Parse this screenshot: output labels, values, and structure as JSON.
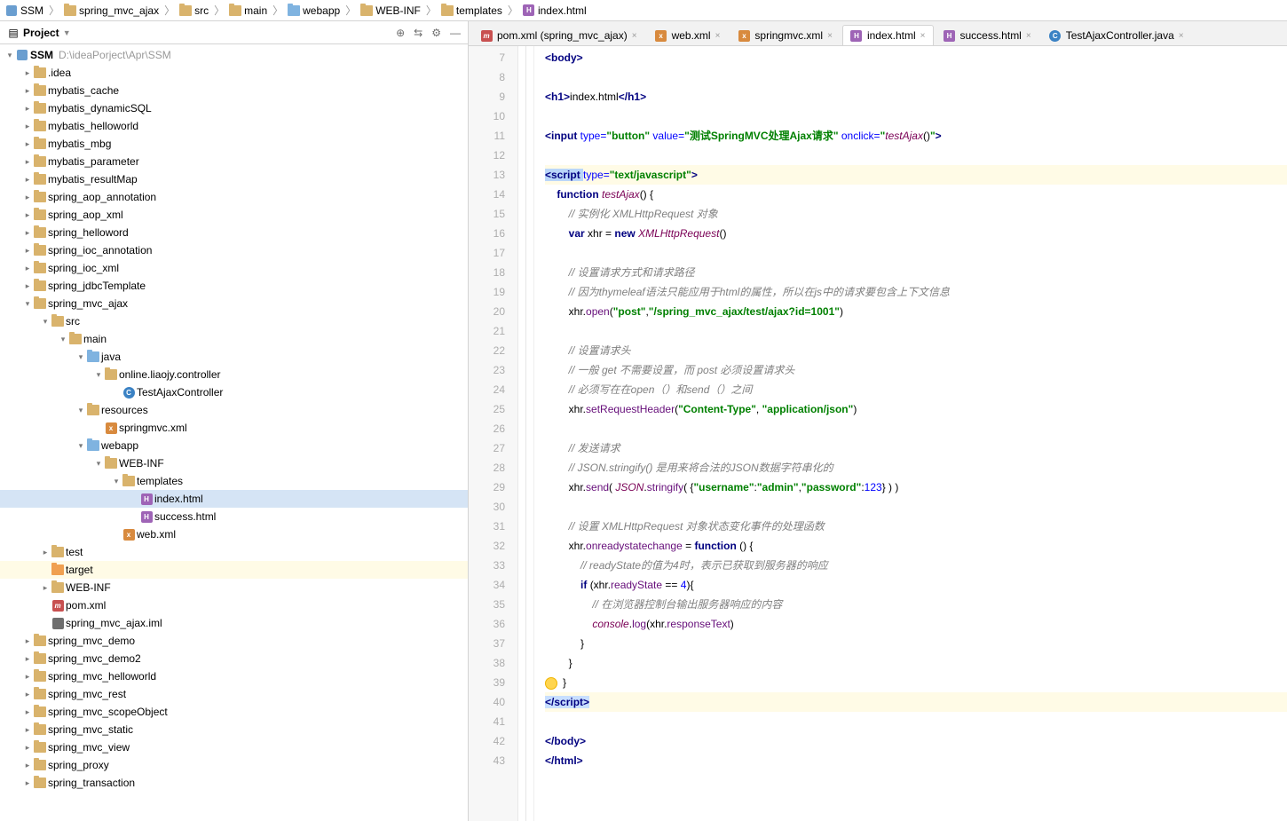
{
  "breadcrumb": [
    {
      "icon": "mod",
      "label": "SSM"
    },
    {
      "icon": "fold",
      "label": "spring_mvc_ajax"
    },
    {
      "icon": "fold",
      "label": "src"
    },
    {
      "icon": "fold",
      "label": "main"
    },
    {
      "icon": "fold-blue",
      "label": "webapp"
    },
    {
      "icon": "fold",
      "label": "WEB-INF"
    },
    {
      "icon": "fold",
      "label": "templates"
    },
    {
      "icon": "h",
      "label": "index.html"
    }
  ],
  "project": {
    "label": "Project"
  },
  "root": {
    "name": "SSM",
    "path": "D:\\ideaPorject\\Apr\\SSM"
  },
  "tree": [
    {
      "d": 1,
      "a": "right",
      "i": "fold",
      "t": ".idea"
    },
    {
      "d": 1,
      "a": "right",
      "i": "fold",
      "t": "mybatis_cache"
    },
    {
      "d": 1,
      "a": "right",
      "i": "fold",
      "t": "mybatis_dynamicSQL"
    },
    {
      "d": 1,
      "a": "right",
      "i": "fold",
      "t": "mybatis_helloworld"
    },
    {
      "d": 1,
      "a": "right",
      "i": "fold",
      "t": "mybatis_mbg"
    },
    {
      "d": 1,
      "a": "right",
      "i": "fold",
      "t": "mybatis_parameter"
    },
    {
      "d": 1,
      "a": "right",
      "i": "fold",
      "t": "mybatis_resultMap"
    },
    {
      "d": 1,
      "a": "right",
      "i": "fold",
      "t": "spring_aop_annotation"
    },
    {
      "d": 1,
      "a": "right",
      "i": "fold",
      "t": "spring_aop_xml"
    },
    {
      "d": 1,
      "a": "right",
      "i": "fold",
      "t": "spring_helloword"
    },
    {
      "d": 1,
      "a": "right",
      "i": "fold",
      "t": "spring_ioc_annotation"
    },
    {
      "d": 1,
      "a": "right",
      "i": "fold",
      "t": "spring_ioc_xml"
    },
    {
      "d": 1,
      "a": "right",
      "i": "fold",
      "t": "spring_jdbcTemplate"
    },
    {
      "d": 1,
      "a": "down",
      "i": "fold",
      "t": "spring_mvc_ajax"
    },
    {
      "d": 2,
      "a": "down",
      "i": "fold",
      "t": "src"
    },
    {
      "d": 3,
      "a": "down",
      "i": "fold",
      "t": "main"
    },
    {
      "d": 4,
      "a": "down",
      "i": "fold-blue",
      "t": "java"
    },
    {
      "d": 5,
      "a": "down",
      "i": "fold",
      "t": "online.liaojy.controller"
    },
    {
      "d": 6,
      "a": "none",
      "i": "j",
      "t": "TestAjaxController"
    },
    {
      "d": 4,
      "a": "down",
      "i": "fold",
      "t": "resources"
    },
    {
      "d": 5,
      "a": "none",
      "i": "x",
      "t": "springmvc.xml"
    },
    {
      "d": 4,
      "a": "down",
      "i": "fold-blue",
      "t": "webapp"
    },
    {
      "d": 5,
      "a": "down",
      "i": "fold",
      "t": "WEB-INF"
    },
    {
      "d": 6,
      "a": "down",
      "i": "fold",
      "t": "templates"
    },
    {
      "d": 7,
      "a": "none",
      "i": "h",
      "t": "index.html",
      "sel": true
    },
    {
      "d": 7,
      "a": "none",
      "i": "h",
      "t": "success.html"
    },
    {
      "d": 6,
      "a": "none",
      "i": "x",
      "t": "web.xml"
    },
    {
      "d": 2,
      "a": "right",
      "i": "fold",
      "t": "test"
    },
    {
      "d": 2,
      "a": "none",
      "i": "fold-orange",
      "t": "target",
      "tgt": true
    },
    {
      "d": 2,
      "a": "right",
      "i": "fold",
      "t": "WEB-INF"
    },
    {
      "d": 2,
      "a": "none",
      "i": "m",
      "t": "pom.xml"
    },
    {
      "d": 2,
      "a": "none",
      "i": "iml",
      "t": "spring_mvc_ajax.iml"
    },
    {
      "d": 1,
      "a": "right",
      "i": "fold",
      "t": "spring_mvc_demo"
    },
    {
      "d": 1,
      "a": "right",
      "i": "fold",
      "t": "spring_mvc_demo2"
    },
    {
      "d": 1,
      "a": "right",
      "i": "fold",
      "t": "spring_mvc_helloworld"
    },
    {
      "d": 1,
      "a": "right",
      "i": "fold",
      "t": "spring_mvc_rest"
    },
    {
      "d": 1,
      "a": "right",
      "i": "fold",
      "t": "spring_mvc_scopeObject"
    },
    {
      "d": 1,
      "a": "right",
      "i": "fold",
      "t": "spring_mvc_static"
    },
    {
      "d": 1,
      "a": "right",
      "i": "fold",
      "t": "spring_mvc_view"
    },
    {
      "d": 1,
      "a": "right",
      "i": "fold",
      "t": "spring_proxy"
    },
    {
      "d": 1,
      "a": "right",
      "i": "fold",
      "t": "spring_transaction"
    }
  ],
  "tabs": [
    {
      "i": "m",
      "t": "pom.xml (spring_mvc_ajax)"
    },
    {
      "i": "x",
      "t": "web.xml"
    },
    {
      "i": "x",
      "t": "springmvc.xml"
    },
    {
      "i": "h",
      "t": "index.html",
      "active": true
    },
    {
      "i": "h",
      "t": "success.html"
    },
    {
      "i": "j",
      "t": "TestAjaxController.java"
    }
  ],
  "gutterStart": 7,
  "gutterEnd": 43,
  "code": [
    {
      "html": "<span class='k'>&lt;body&gt;</span>"
    },
    {
      "html": ""
    },
    {
      "html": "<span class='k'>&lt;h1&gt;</span>index.html<span class='k'>&lt;/h1&gt;</span>"
    },
    {
      "html": ""
    },
    {
      "html": "<span class='k'>&lt;input </span><span class='attr'>type=</span><span class='str'>\"button\"</span> <span class='attr'>value=</span><span class='str'>\"测试SpringMVC处理Ajax请求\"</span> <span class='attr'>onclick=</span><span class='str'>\"</span><span class='fn'>testAjax</span>()<span class='str'>\"</span><span class='k'>&gt;</span>"
    },
    {
      "html": ""
    },
    {
      "html": "<span class='sel-b2'><span class='k'>&lt;script </span></span><span class='attr'>type=</span><span class='str'>\"text/javascript\"</span><span class='k'>&gt;</span>",
      "hl": true
    },
    {
      "html": "    <span class='k'>function </span><span class='fn'>testAjax</span>() {"
    },
    {
      "html": "        <span class='cm'>// 实例化 XMLHttpRequest 对象</span>"
    },
    {
      "html": "        <span class='k'>var </span>xhr = <span class='k'>new </span><span class='fn'>XMLHttpRequest</span>()"
    },
    {
      "html": ""
    },
    {
      "html": "        <span class='cm'>// 设置请求方式和请求路径</span>"
    },
    {
      "html": "        <span class='cm'>// 因为thymeleaf语法只能应用于html的属性，所以在js中的请求要包含上下文信息</span>"
    },
    {
      "html": "        xhr.<span class='prop'>open</span>(<span class='str'>\"post\"</span>,<span class='str'>\"/spring_mvc_ajax/test/ajax?id=1001\"</span>)"
    },
    {
      "html": ""
    },
    {
      "html": "        <span class='cm'>// 设置请求头</span>"
    },
    {
      "html": "        <span class='cm'>// 一般 get 不需要设置，而 post 必须设置请求头</span>"
    },
    {
      "html": "        <span class='cm'>// 必须写在在open（）和send（）之间</span>"
    },
    {
      "html": "        xhr.<span class='prop'>setRequestHeader</span>(<span class='str'>\"Content-Type\"</span>, <span class='str'>\"application/json\"</span>)"
    },
    {
      "html": ""
    },
    {
      "html": "        <span class='cm'>// 发送请求</span>"
    },
    {
      "html": "        <span class='cm'>// JSON.stringify() 是用来将合法的JSON数据字符串化的</span>"
    },
    {
      "html": "        xhr.<span class='prop'>send</span>( <span class='fn'>JSON</span>.<span class='prop'>stringify</span>( {<span class='str'>\"username\"</span>:<span class='str'>\"admin\"</span>,<span class='str'>\"password\"</span>:<span class='num'>123</span>} ) )"
    },
    {
      "html": ""
    },
    {
      "html": "        <span class='cm'>// 设置 XMLHttpRequest 对象状态变化事件的处理函数</span>"
    },
    {
      "html": "        xhr.<span class='prop'>onreadystatechange</span> = <span class='k'>function </span>() {"
    },
    {
      "html": "            <span class='cm'>// readyState的值为4时，表示已获取到服务器的响应</span>"
    },
    {
      "html": "            <span class='k'>if </span>(xhr.<span class='prop'>readyState</span> == <span class='num'>4</span>){"
    },
    {
      "html": "                <span class='cm'>// 在浏览器控制台输出服务器响应的内容</span>"
    },
    {
      "html": "                <span class='fn'>console</span>.<span class='prop'>log</span>(xhr.<span class='prop'>responseText</span>)"
    },
    {
      "html": "            }"
    },
    {
      "html": "        }"
    },
    {
      "html": "<span class='bulb'></span>}"
    },
    {
      "html": "<span class='sel-b'><span class='k'>&lt;/script&gt;</span></span>",
      "hl": true
    },
    {
      "html": ""
    },
    {
      "html": "<span class='k'>&lt;/body&gt;</span>"
    },
    {
      "html": "<span class='k'>&lt;/html&gt;</span>"
    }
  ]
}
